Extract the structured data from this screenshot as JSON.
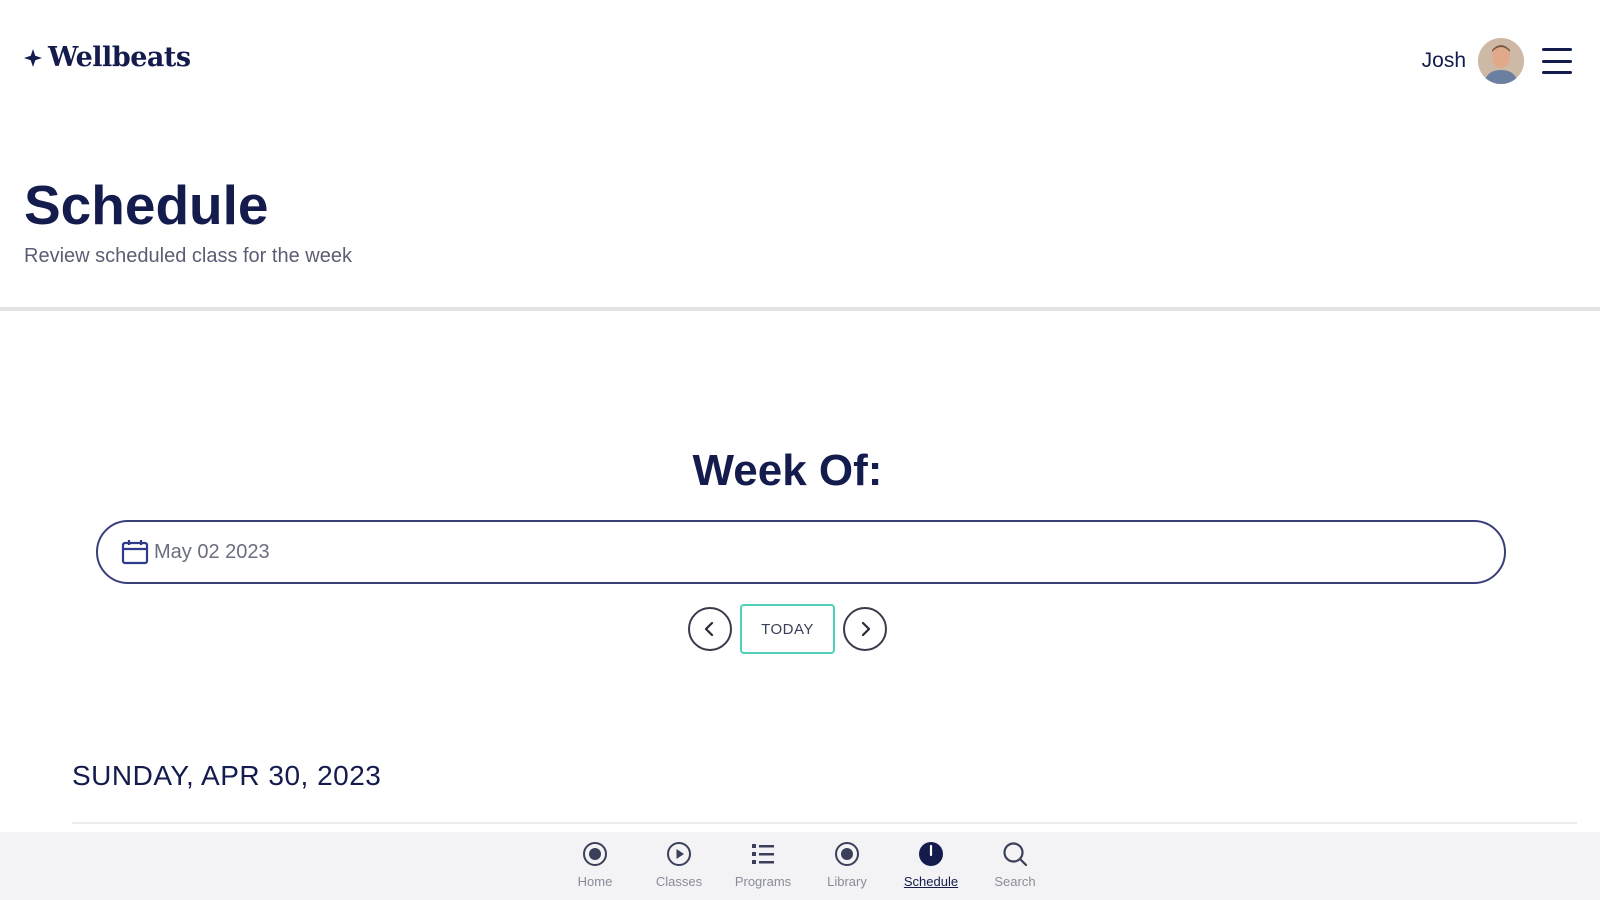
{
  "header": {
    "logo_text": "Wellbeats",
    "user_name": "Josh"
  },
  "page": {
    "title": "Schedule",
    "subtitle": "Review scheduled class for the week"
  },
  "week": {
    "heading": "Week Of:",
    "date_value": "May 02 2023",
    "today_label": "TODAY"
  },
  "day": {
    "header": "SUNDAY, APR 30, 2023"
  },
  "bottom_nav": {
    "items": [
      {
        "label": "Home",
        "icon": "home-icon"
      },
      {
        "label": "Classes",
        "icon": "play-icon"
      },
      {
        "label": "Programs",
        "icon": "list-icon"
      },
      {
        "label": "Library",
        "icon": "library-icon"
      },
      {
        "label": "Schedule",
        "icon": "clock-icon",
        "active": true
      },
      {
        "label": "Search",
        "icon": "search-icon"
      }
    ]
  },
  "colors": {
    "brand_navy": "#141b4d",
    "accent_teal": "#4fd1b8",
    "nav_bg": "#f3f3f5"
  }
}
